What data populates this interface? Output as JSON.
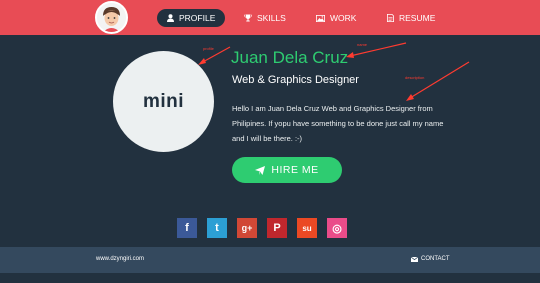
{
  "nav": {
    "profile": "PROFILE",
    "skills": "SKILLS",
    "work": "WORK",
    "resume": "RESUME"
  },
  "icons": {
    "profile": "user-icon",
    "skills": "trophy-icon",
    "work": "image-icon",
    "resume": "document-icon",
    "hire": "paper-plane-icon",
    "contact": "envelope-icon"
  },
  "avatar": {
    "text": "mini"
  },
  "profile": {
    "name": "Juan Dela Cruz",
    "role": "Web & Graphics Designer",
    "description": "Hello I am Juan Dela Cruz Web and Graphics Designer from Philipines. If yopu have something to be done just call my name and I will be there. :-)"
  },
  "hire_button": "HIRE ME",
  "social": [
    {
      "name": "facebook",
      "glyph": "f",
      "color": "#3b5998"
    },
    {
      "name": "twitter",
      "glyph": "t",
      "color": "#2c9fd4"
    },
    {
      "name": "google-plus",
      "glyph": "g+",
      "color": "#d14836"
    },
    {
      "name": "pinterest",
      "glyph": "P",
      "color": "#c0272d"
    },
    {
      "name": "stumbleupon",
      "glyph": "su",
      "color": "#eb4924"
    },
    {
      "name": "dribbble",
      "glyph": "◎",
      "color": "#ea4c89"
    }
  ],
  "footer": {
    "url": "www.dzyngiri.com",
    "contact": "CONTACT"
  },
  "annotations": {
    "profile": "profile",
    "name": "name",
    "description": "description"
  },
  "colors": {
    "header": "#e84c55",
    "background": "#22313f",
    "accent": "#2ecc71",
    "footer": "#34495e",
    "annotation": "#ff3b30"
  }
}
